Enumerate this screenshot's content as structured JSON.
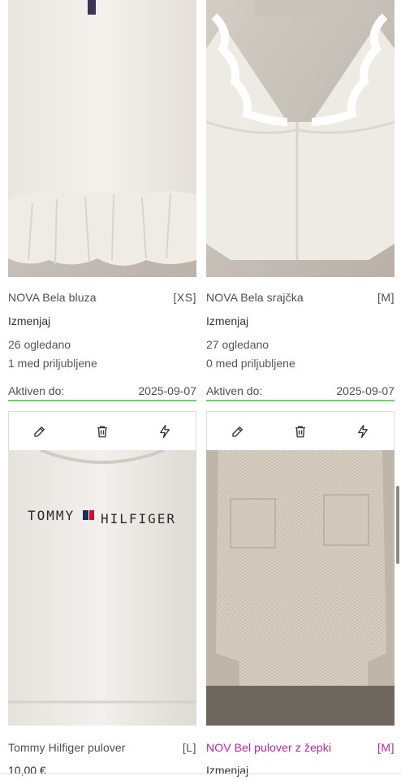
{
  "listings": [
    {
      "title": "NOVA Bela bluza",
      "size": "[XS]",
      "edit_label": "Izmenjaj",
      "views": "26 ogledano",
      "favorites": "1 med priljubljene",
      "active_label": "Aktiven do:",
      "active_date": "2025-09-07",
      "image": "white blouse with peplum ruffle"
    },
    {
      "title": "NOVA Bela srajčka",
      "size": "[M]",
      "edit_label": "Izmenjaj",
      "views": "27 ogledano",
      "favorites": "0 med priljubljene",
      "active_label": "Aktiven do:",
      "active_date": "2025-09-07",
      "image": "white shirt with ruffled collar"
    },
    {
      "title": "Tommy Hilfiger pulover",
      "size": "[L]",
      "price": "10,00 €",
      "logo_text": "TOMMY HILFIGER",
      "image": "white Tommy Hilfiger sweatshirt",
      "toolbar": {
        "edit_icon": "pencil-icon",
        "delete_icon": "trash-icon",
        "boost_icon": "lightning-icon"
      }
    },
    {
      "title": "NOV Bel pulover z žepki",
      "size": "[M]",
      "edit_label": "Izmenjaj",
      "title_color": "#c2269a",
      "image": "cream knit sweater with pockets",
      "toolbar": {
        "edit_icon": "pencil-icon",
        "delete_icon": "trash-icon",
        "boost_icon": "lightning-icon"
      }
    }
  ],
  "colors": {
    "active_underline": "#6fcf6a",
    "highlight_title": "#c2269a"
  }
}
